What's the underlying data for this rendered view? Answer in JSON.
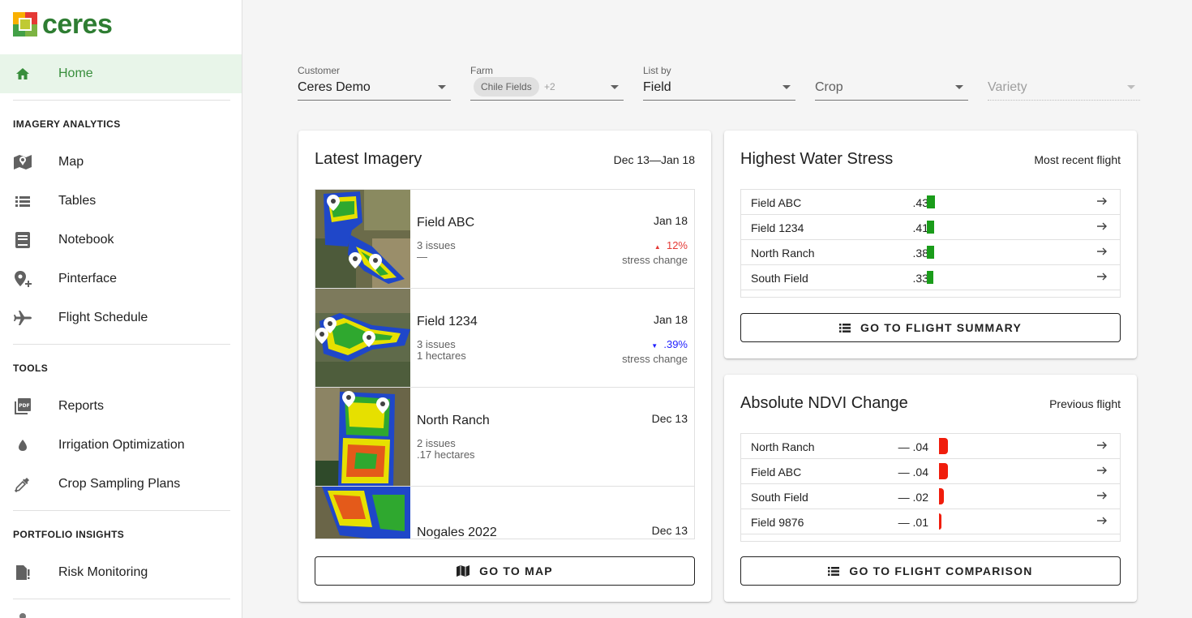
{
  "app": {
    "logo_text": "ceres"
  },
  "sidebar": {
    "home": "Home",
    "sections": {
      "imagery": "IMAGERY ANALYTICS",
      "tools": "TOOLS",
      "portfolio": "PORTFOLIO INSIGHTS"
    },
    "items": {
      "map": "Map",
      "tables": "Tables",
      "notebook": "Notebook",
      "pinterface": "Pinterface",
      "flight_schedule": "Flight Schedule",
      "reports": "Reports",
      "irrigation": "Irrigation Optimization",
      "crop_sampling": "Crop Sampling Plans",
      "risk": "Risk Monitoring"
    }
  },
  "filters": {
    "customer": {
      "label": "Customer",
      "value": "Ceres Demo"
    },
    "farm": {
      "label": "Farm",
      "chip": "Chile Fields",
      "more": "+2"
    },
    "list_by": {
      "label": "List by",
      "value": "Field"
    },
    "crop": {
      "placeholder": "Crop"
    },
    "variety": {
      "placeholder": "Variety"
    }
  },
  "imagery": {
    "title": "Latest Imagery",
    "range": "Dec 13—Jan 18",
    "button": "GO TO MAP",
    "rows": [
      {
        "name": "Field ABC",
        "date": "Jan 18",
        "meta1": "3 issues",
        "meta2": "—",
        "pct": "12%",
        "pct_dir": "up",
        "change_label": "stress change"
      },
      {
        "name": "Field 1234",
        "date": "Jan 18",
        "meta1": "3 issues",
        "meta2": "1 hectares",
        "pct": ".39%",
        "pct_dir": "down",
        "change_label": "stress change"
      },
      {
        "name": "North Ranch",
        "date": "Dec 13",
        "meta1": "2 issues",
        "meta2": ".17 hectares"
      },
      {
        "name": "Nogales 2022",
        "date": "Dec 13"
      }
    ]
  },
  "water_stress": {
    "title": "Highest Water Stress",
    "subtitle": "Most recent flight",
    "button": "GO TO FLIGHT SUMMARY",
    "bar_color": "#1a9c1a",
    "rows": [
      {
        "name": "Field ABC",
        "value": ".43",
        "level": 0.43
      },
      {
        "name": "Field 1234",
        "value": ".41",
        "level": 0.41
      },
      {
        "name": "North Ranch",
        "value": ".38",
        "level": 0.38
      },
      {
        "name": "South Field",
        "value": ".33",
        "level": 0.33
      }
    ]
  },
  "ndvi": {
    "title": "Absolute NDVI Change",
    "subtitle": "Previous flight",
    "button": "GO TO FLIGHT COMPARISON",
    "bar_color": "#f01d0c",
    "rows": [
      {
        "name": "North Ranch",
        "value": "— .04",
        "level": 0.04
      },
      {
        "name": "Field ABC",
        "value": "— .04",
        "level": 0.04
      },
      {
        "name": "South Field",
        "value": "— .02",
        "level": 0.02
      },
      {
        "name": "Field 9876",
        "value": "— .01",
        "level": 0.01
      }
    ]
  },
  "colors": {
    "brand_green": "#2e7d32",
    "active_bg": "#e8f5e9",
    "stress_up": "#e53935",
    "stress_down": "#1e1eff"
  }
}
